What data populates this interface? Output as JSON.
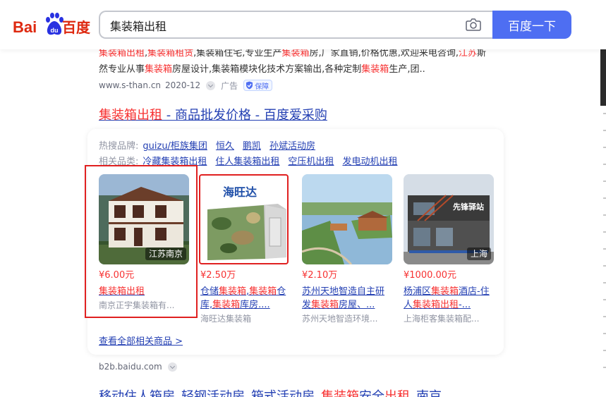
{
  "header": {
    "logo_bai": "Bai",
    "logo_cn": "百度",
    "search_value": "集装箱出租",
    "search_button": "百度一下",
    "camera_icon": "camera-icon"
  },
  "result1": {
    "line1": [
      {
        "t": "集装箱出租",
        "red": true
      },
      {
        "t": ",",
        "red": false
      },
      {
        "t": "集装箱租赁",
        "red": true
      },
      {
        "t": ",集装箱住宅,专业生产",
        "red": false
      },
      {
        "t": "集装箱",
        "red": true
      },
      {
        "t": "房,厂家直销,价格优惠,欢迎来电咨询,",
        "red": false
      },
      {
        "t": "江苏",
        "red": true
      },
      {
        "t": "斯",
        "red": false
      }
    ],
    "line2": [
      {
        "t": "然专业从事",
        "red": false
      },
      {
        "t": "集装箱",
        "red": true
      },
      {
        "t": "房屋设计,集装箱模块化技术方案输出,各种定制",
        "red": false
      },
      {
        "t": "集装箱",
        "red": true
      },
      {
        "t": "生产,团..",
        "red": false
      }
    ],
    "url": "www.s-than.cn",
    "date": "2020-12",
    "ad": "广告",
    "guarantee": "保障"
  },
  "result2": {
    "title_red": "集装箱出租",
    "title_rest": " - 商品批发价格 - 百度爱采购",
    "hot_label": "热搜品牌:",
    "hot_tags": [
      "guizu/柜族集团",
      "恒久",
      "鹏凯",
      "孙斌活动房"
    ],
    "related_label": "相关品类:",
    "related_tags": [
      "冷藏集装箱出租",
      "住人集装箱出租",
      "空压机出租",
      "发电动机出租"
    ],
    "products": [
      {
        "price": "¥6.00元",
        "name_parts": [
          {
            "t": "集装箱出租",
            "red": true
          }
        ],
        "shop": "南京正宇集装箱有...",
        "loc": "江苏南京"
      },
      {
        "price": "¥2.50万",
        "name_parts": [
          {
            "t": "仓储",
            "red": false
          },
          {
            "t": "集装箱",
            "red": true
          },
          {
            "t": ",",
            "red": false
          },
          {
            "t": "集装箱",
            "red": true
          },
          {
            "t": "仓库,",
            "red": false
          },
          {
            "t": "集装箱",
            "red": true
          },
          {
            "t": "库房....",
            "red": false
          }
        ],
        "shop": "海旺达集装箱",
        "loc": "",
        "brand": "海旺达"
      },
      {
        "price": "¥2.10万",
        "name_parts": [
          {
            "t": "苏州天地智造自主研发",
            "red": false
          },
          {
            "t": "集装箱",
            "red": true
          },
          {
            "t": "房屋、...",
            "red": false
          }
        ],
        "shop": "苏州天地智造环境...",
        "loc": ""
      },
      {
        "price": "¥1000.00元",
        "name_parts": [
          {
            "t": "杨浦区",
            "red": false
          },
          {
            "t": "集装箱",
            "red": true
          },
          {
            "t": "酒店-住人",
            "red": false
          },
          {
            "t": "集装箱出租",
            "red": true
          },
          {
            "t": "-...",
            "red": false
          }
        ],
        "shop": "上海柜客集装箱配...",
        "loc": "上海",
        "sign": "先锋驿站"
      }
    ],
    "view_all": "查看全部相关商品 >",
    "url": "b2b.baidu.com"
  },
  "result3": {
    "title_parts": [
      {
        "t": "移动住人箱房_轻钢活动房_箱式活动房_",
        "red": false
      },
      {
        "t": "集装箱",
        "red": true
      },
      {
        "t": "安全",
        "red": false
      },
      {
        "t": "出租",
        "red": true
      },
      {
        "t": "_南京...",
        "red": false
      }
    ]
  },
  "colors": {
    "brand_blue": "#4e6ef2",
    "link_blue": "#2440b3",
    "highlight_red": "#f73131",
    "annotation_red": "#e02020"
  }
}
